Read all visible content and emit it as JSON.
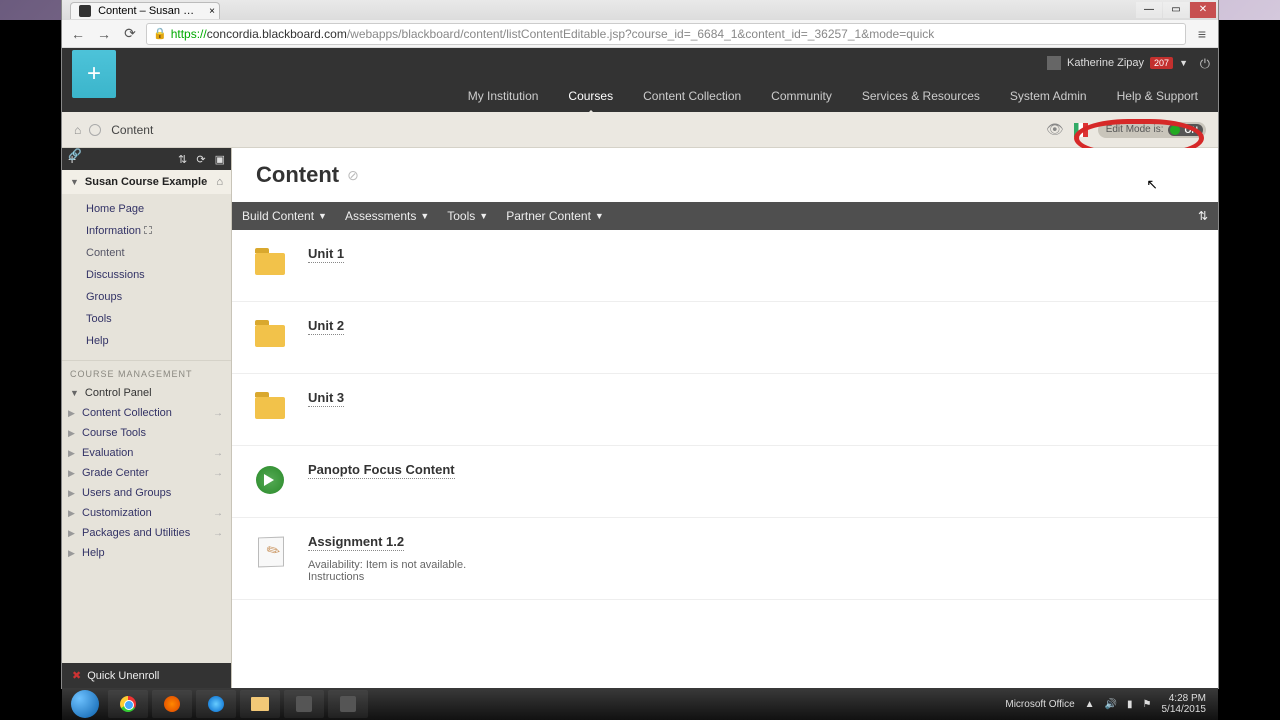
{
  "browser": {
    "tab_title": "Content – Susan Course E",
    "url_proto": "https://",
    "url_host": "concordia.blackboard.com",
    "url_path": "/webapps/blackboard/content/listContentEditable.jsp?course_id=_6684_1&content_id=_36257_1&mode=quick"
  },
  "user": {
    "name": "Katherine Zipay",
    "notif_count": "207"
  },
  "top_nav": {
    "items": [
      "My Institution",
      "Courses",
      "Content Collection",
      "Community",
      "Services & Resources",
      "System Admin",
      "Help & Support"
    ],
    "active_index": 1
  },
  "breadcrumb": {
    "label": "Content"
  },
  "edit_mode": {
    "label": "Edit Mode is:",
    "state": "ON"
  },
  "sidebar": {
    "course_title": "Susan Course Example",
    "menu": [
      "Home Page",
      "Information",
      "Content",
      "Discussions",
      "Groups",
      "Tools",
      "Help"
    ],
    "menu_active_index": 2,
    "cm_header": "COURSE MANAGEMENT",
    "cp_title": "Control Panel",
    "cp_menu": [
      "Content Collection",
      "Course Tools",
      "Evaluation",
      "Grade Center",
      "Users and Groups",
      "Customization",
      "Packages and Utilities",
      "Help"
    ],
    "quick_unenroll": "Quick Unenroll"
  },
  "page": {
    "title": "Content"
  },
  "action_bar": {
    "items": [
      "Build Content",
      "Assessments",
      "Tools",
      "Partner Content"
    ]
  },
  "content_items": [
    {
      "title": "Unit 1",
      "type": "folder"
    },
    {
      "title": "Unit 2",
      "type": "folder"
    },
    {
      "title": "Unit 3",
      "type": "folder"
    },
    {
      "title": "Panopto Focus Content",
      "type": "panopto"
    },
    {
      "title": "Assignment 1.2",
      "type": "assignment",
      "meta_label_availability": "Availability:",
      "meta_availability": "Item is not available.",
      "meta_label_instructions": "Instructions"
    }
  ],
  "taskbar": {
    "tray_app": "Microsoft Office",
    "time": "4:28 PM",
    "date": "5/14/2015"
  }
}
